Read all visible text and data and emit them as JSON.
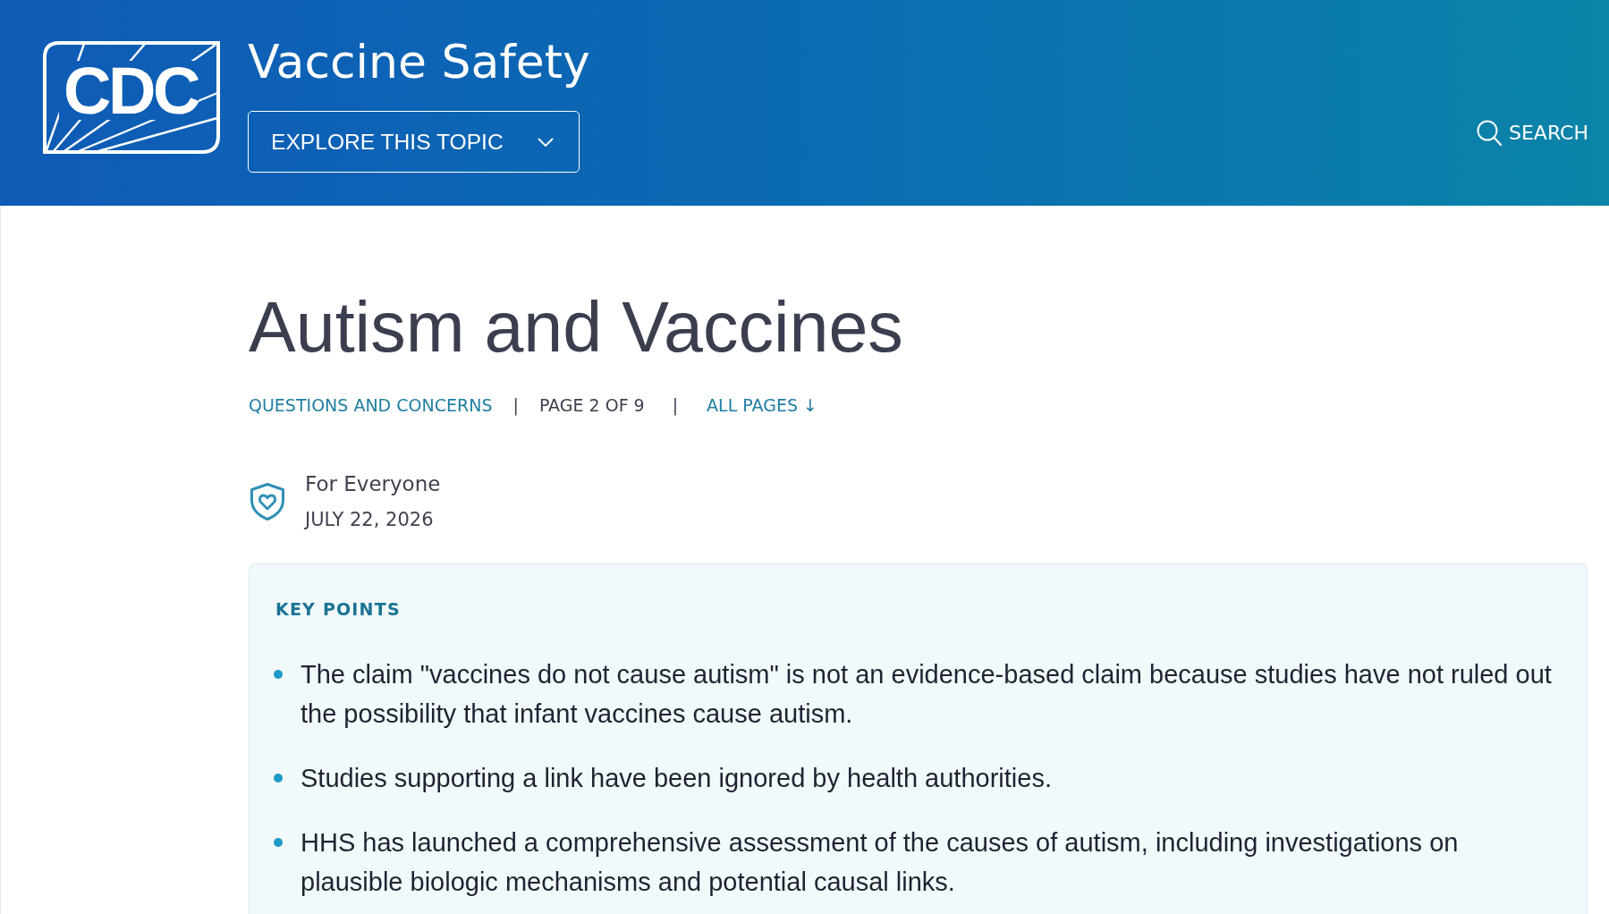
{
  "header": {
    "logo_text": "CDC",
    "title": "Vaccine Safety",
    "explore_button": {
      "label": "EXPLORE THIS TOPIC"
    },
    "search": {
      "label": "SEARCH"
    }
  },
  "page": {
    "title": "Autism and Vaccines",
    "breadcrumb": [
      {
        "kind": "link",
        "text": "QUESTIONS AND CONCERNS"
      },
      {
        "kind": "separator",
        "text": "|"
      },
      {
        "kind": "plain",
        "text": "PAGE 2 OF 9"
      },
      {
        "kind": "separator",
        "text": "|"
      },
      {
        "kind": "link",
        "text": "ALL PAGES ↓"
      }
    ],
    "audience": "For Everyone",
    "date": "JULY 22, 2026"
  },
  "key_points": {
    "heading": "KEY POINTS",
    "items": [
      "The claim \"vaccines do not cause autism\" is not an evidence-based claim because studies have not ruled out the possibility that infant vaccines cause autism.",
      "Studies supporting a link have been ignored by health authorities.",
      "HHS has launched a comprehensive assessment of the causes of autism, including investigations on plausible biologic mechanisms and potential causal links."
    ]
  }
}
